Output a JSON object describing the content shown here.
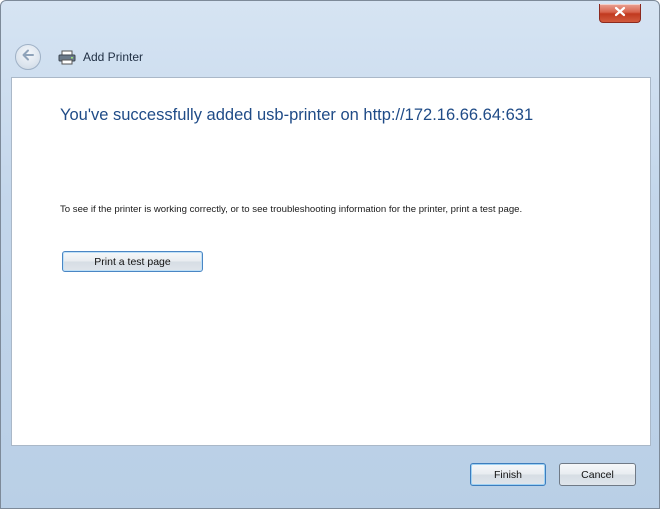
{
  "window": {
    "close_icon": "close-icon",
    "close_color": "#c1391f"
  },
  "header": {
    "title": "Add Printer",
    "back_icon": "back-arrow-icon",
    "printer_icon": "printer-icon"
  },
  "main": {
    "heading": "You've successfully added usb-printer on http://172.16.66.64:631",
    "info": "To see if the printer is working correctly, or to see troubleshooting information for the printer, print a test page.",
    "test_button_label": "Print a test page"
  },
  "footer": {
    "finish_label": "Finish",
    "cancel_label": "Cancel"
  },
  "colors": {
    "heading": "#1f4b87",
    "frame": "#c3d6eb"
  }
}
